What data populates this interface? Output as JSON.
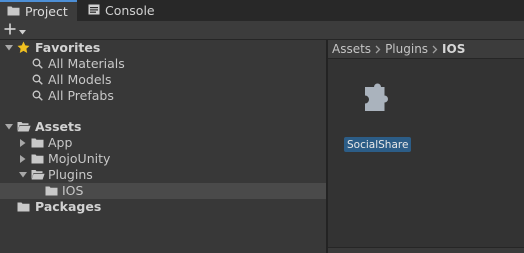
{
  "tabs": {
    "project": {
      "label": "Project",
      "icon": "folder-icon"
    },
    "console": {
      "label": "Console",
      "icon": "console-icon"
    }
  },
  "toolbar": {
    "add_icon": "plus-icon",
    "dropdown_icon": "chevron-down-icon"
  },
  "tree": {
    "favorites": {
      "label": "Favorites",
      "items": [
        {
          "label": "All Materials"
        },
        {
          "label": "All Models"
        },
        {
          "label": "All Prefabs"
        }
      ]
    },
    "assets": {
      "label": "Assets",
      "children": [
        {
          "label": "App"
        },
        {
          "label": "MojoUnity"
        },
        {
          "label": "Plugins",
          "expanded": true,
          "children": [
            {
              "label": "IOS",
              "selected": true
            }
          ]
        }
      ]
    },
    "packages": {
      "label": "Packages"
    }
  },
  "breadcrumb": {
    "items": [
      {
        "label": "Assets"
      },
      {
        "label": "Plugins"
      },
      {
        "label": "IOS"
      }
    ]
  },
  "asset_grid": {
    "items": [
      {
        "label": "SocialShare",
        "icon": "plugin-puzzle-icon"
      }
    ]
  },
  "colors": {
    "accent": "#4d8fd6",
    "selection": "#2c5d87",
    "star": "#f0c020",
    "panel": "#383838"
  }
}
